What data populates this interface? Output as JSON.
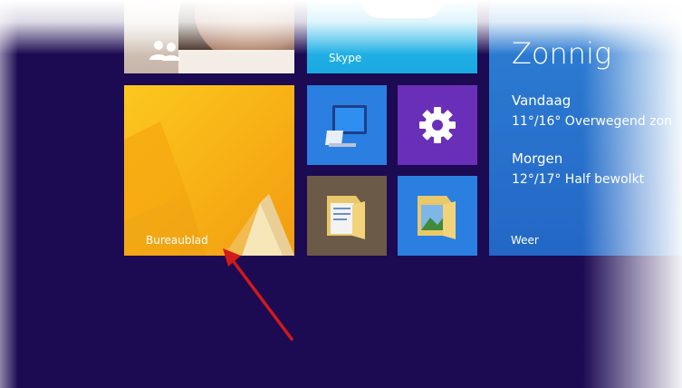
{
  "tiles": {
    "people": {
      "icon": "people-icon"
    },
    "skype": {
      "label": "Skype",
      "icon": "skype-cloud-icon"
    },
    "weather": {
      "title": "Zonnig",
      "today_label": "Vandaag",
      "today_forecast": "11°/16° Overwegend zon",
      "tomorrow_label": "Morgen",
      "tomorrow_forecast": "12°/17° Half bewolkt",
      "label": "Weer"
    },
    "desktop": {
      "label": "Bureaublad"
    },
    "pc": {
      "icon": "computer-icon"
    },
    "settings": {
      "icon": "gear-icon"
    },
    "documents": {
      "icon": "documents-folder-icon"
    },
    "pictures": {
      "icon": "pictures-folder-icon"
    }
  },
  "colors": {
    "background": "#1c0a52",
    "desktop_tile": "#fcc81f",
    "skype_tile": "#1aa8e0",
    "weather_tile": "#2467c6",
    "settings_tile": "#6a2fb8",
    "pc_tile": "#2a7fe0",
    "documents_tile": "#6b5a48",
    "arrow": "#d11a1a"
  }
}
